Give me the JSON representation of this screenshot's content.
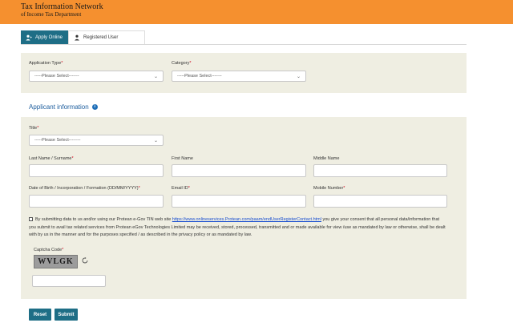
{
  "header": {
    "title": "Tax Information Network",
    "subtitle": "of Income Tax Department"
  },
  "tabs": [
    {
      "label": "Apply Online",
      "active": true
    },
    {
      "label": "Registered User",
      "active": false
    }
  ],
  "form_top": {
    "application_type": {
      "label": "Application Type",
      "required_mark": "*",
      "value": "-----Please Select-------"
    },
    "category": {
      "label": "Category",
      "required_mark": "*",
      "value": "-----Please Select-------"
    }
  },
  "applicant": {
    "section_title": "Applicant information",
    "title": {
      "label": "Title",
      "required_mark": "*",
      "value": "-----Please Select--------"
    },
    "last_name": {
      "label": "Last Name / Surname",
      "required_mark": "*",
      "value": ""
    },
    "first_name": {
      "label": "First Name",
      "value": ""
    },
    "middle_name": {
      "label": "Middle Name",
      "value": ""
    },
    "dob": {
      "label": "Date of Birth / Incorporation / Formation (DD/MM/YYYY)",
      "required_mark": "*",
      "value": ""
    },
    "email": {
      "label": "Email ID",
      "required_mark": "*",
      "value": ""
    },
    "mobile": {
      "label": "Mobile Number",
      "required_mark": "*",
      "value": ""
    }
  },
  "consent": {
    "checked": false,
    "text_before": "By submitting data to us and/or using our Protean e-Gov TIN web site ",
    "link": "https://www.onlineservices.Protean.com/paam/endUserRegisterContact.html",
    "text_after": " you give your consent that all personal data/information that you submit to avail tax related services from Protean eGov Technologies Limited may be received, stored, processed, transmitted and or made available for view /use as mandated by law or otherwise, shall be dealt with by us in the manner and for the purposes specified / as described in the privacy policy or as mandated by law."
  },
  "captcha": {
    "label": "Captcha Code",
    "required_mark": "*",
    "code": "WVLGK",
    "value": ""
  },
  "buttons": {
    "reset": "Reset",
    "submit": "Submit"
  },
  "colors": {
    "header": "#f5902f",
    "primary": "#1e6e86",
    "panel": "#efeee2",
    "required": "#d0021b"
  },
  "icons": {
    "apply_online": "user-plus-icon",
    "registered_user": "user-icon",
    "info": "info-icon",
    "refresh": "refresh-icon",
    "dropdown": "chevron-down-icon"
  }
}
